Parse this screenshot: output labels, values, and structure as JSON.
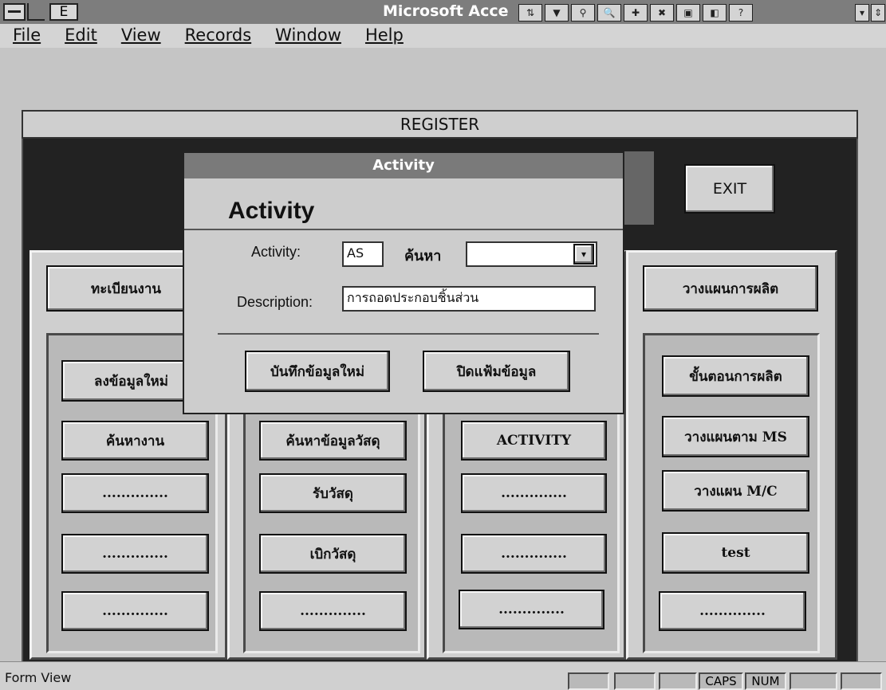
{
  "app": {
    "title": "Microsoft Acce",
    "sys_letter": "E"
  },
  "menu": [
    "File",
    "Edit",
    "View",
    "Records",
    "Window",
    "Help"
  ],
  "register": {
    "title": "REGISTER",
    "exit_label": "EXIT"
  },
  "columns": [
    {
      "header": "ทะเบียนงาน",
      "buttons": [
        "ลงข้อมูลใหม่",
        "ค้นหางาน",
        "..............",
        "..............",
        ".............."
      ]
    },
    {
      "header": "",
      "buttons": [
        "",
        "ค้นหาข้อมูลวัสดุ",
        "รับวัสดุ",
        "เบิกวัสดุ",
        ".............."
      ]
    },
    {
      "header": "",
      "buttons": [
        "",
        "ACTIVITY",
        "..............",
        "..............",
        ".............."
      ]
    },
    {
      "header": "วางแผนการผลิต",
      "buttons": [
        "ขั้นตอนการผลิต",
        "วางแผนตาม MS",
        "วางแผน M/C",
        "test",
        ".............."
      ]
    }
  ],
  "dialog": {
    "title": "Activity",
    "heading": "Activity",
    "activity_label": "Activity:",
    "activity_value": "AS",
    "search_label": "ค้นหา",
    "search_value": "",
    "description_label": "Description:",
    "description_value": "การถอดประกอบชิ้นส่วน",
    "save_label": "บันทึกข้อมูลใหม่",
    "close_label": "ปิดแฟ้มข้อมูล"
  },
  "status": {
    "view": "Form View",
    "caps": "CAPS",
    "num": "NUM"
  }
}
